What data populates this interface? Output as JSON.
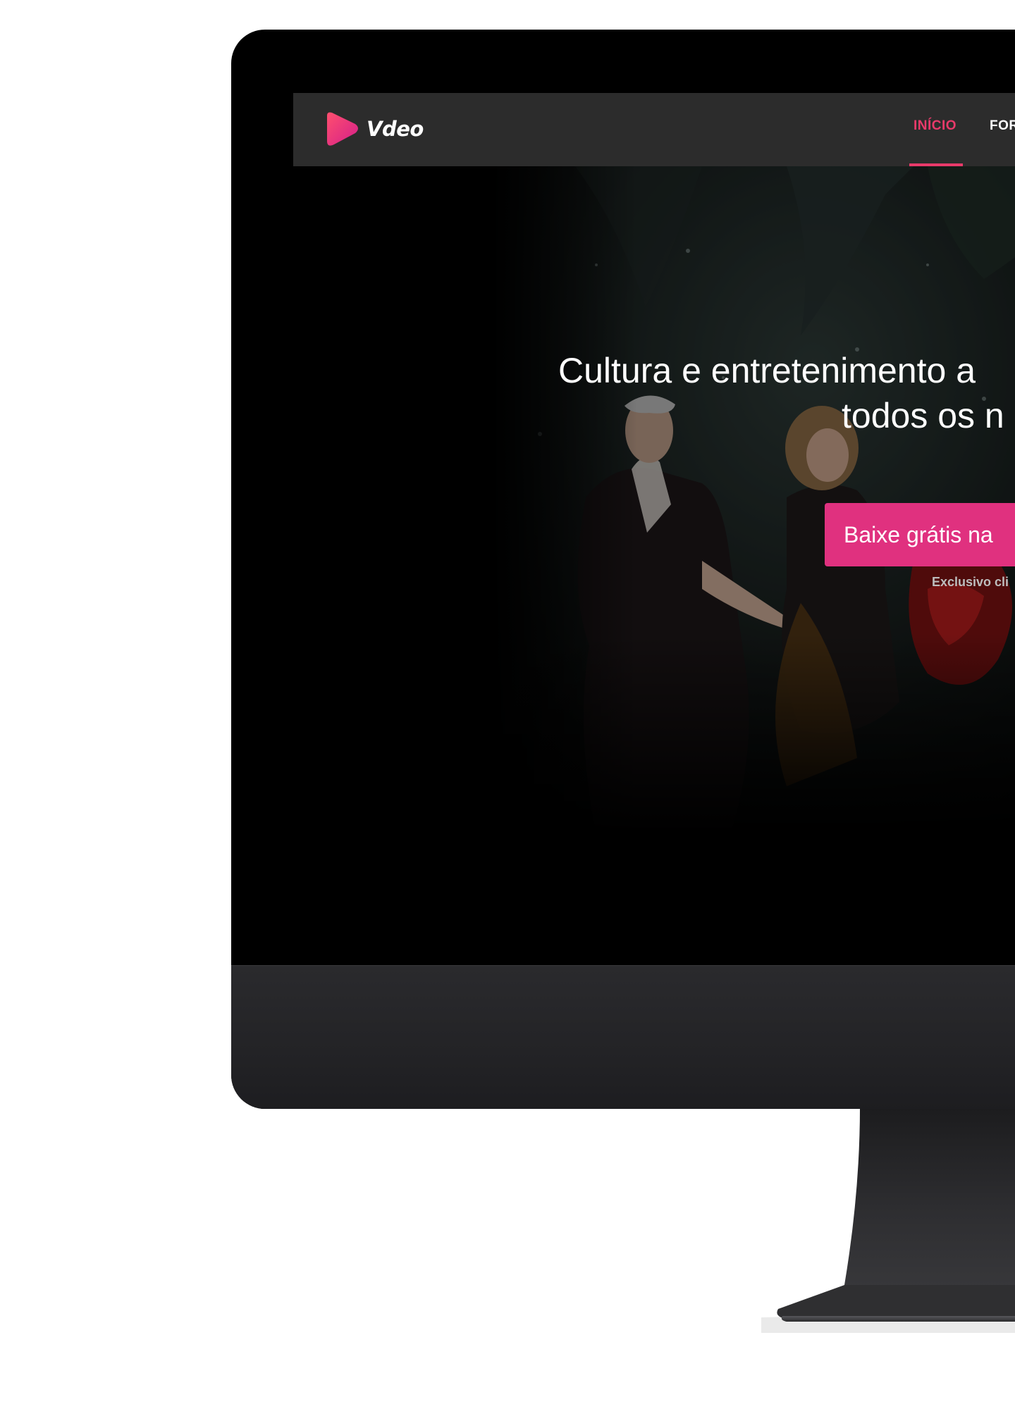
{
  "brand": {
    "name": "Vdeo",
    "accent_color": "#e83a6a",
    "cta_color": "#e0317f"
  },
  "nav": {
    "items": [
      {
        "label": "INÍCIO",
        "active": true
      },
      {
        "label": "FOR",
        "active": false
      }
    ]
  },
  "hero": {
    "headline_line1": "Cultura e entretenimento a",
    "headline_line2": "todos os n",
    "cta_label": "Baixe grátis na",
    "cta_note": "Exclusivo cli",
    "scroll_icon": "chevron-down-icon"
  },
  "features": {
    "device_icon": "tablet-icon"
  }
}
